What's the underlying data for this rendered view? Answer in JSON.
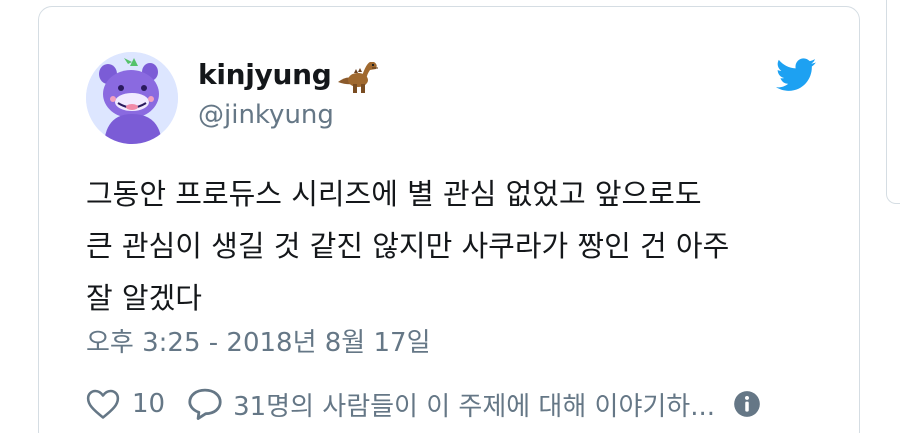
{
  "tweet": {
    "display_name": "kinjyung",
    "display_name_emoji": "dinosaur-emoji",
    "handle": "@jinkyung",
    "text_lines": [
      "그동안 프로듀스 시리즈에 별 관심 없었고 앞으로도",
      "큰 관심이 생길 것 같진 않지만 사쿠라가 짱인 건 아주",
      "잘 알겠다"
    ],
    "timestamp": "오후 3:25 - 2018년 8월 17일",
    "like_count": "10",
    "conversation_label": "31명의 사람들이 이 주제에 대해 이야기하..."
  },
  "icons": {
    "avatar": "purple-creature-avatar",
    "logo": "twitter-bird-icon",
    "like": "heart-outline-icon",
    "reply": "speech-bubble-icon",
    "info": "info-circle-icon"
  },
  "colors": {
    "twitter_blue": "#1da1f2",
    "text_primary": "#14171a",
    "text_secondary": "#657786",
    "border": "#d5dde3"
  }
}
